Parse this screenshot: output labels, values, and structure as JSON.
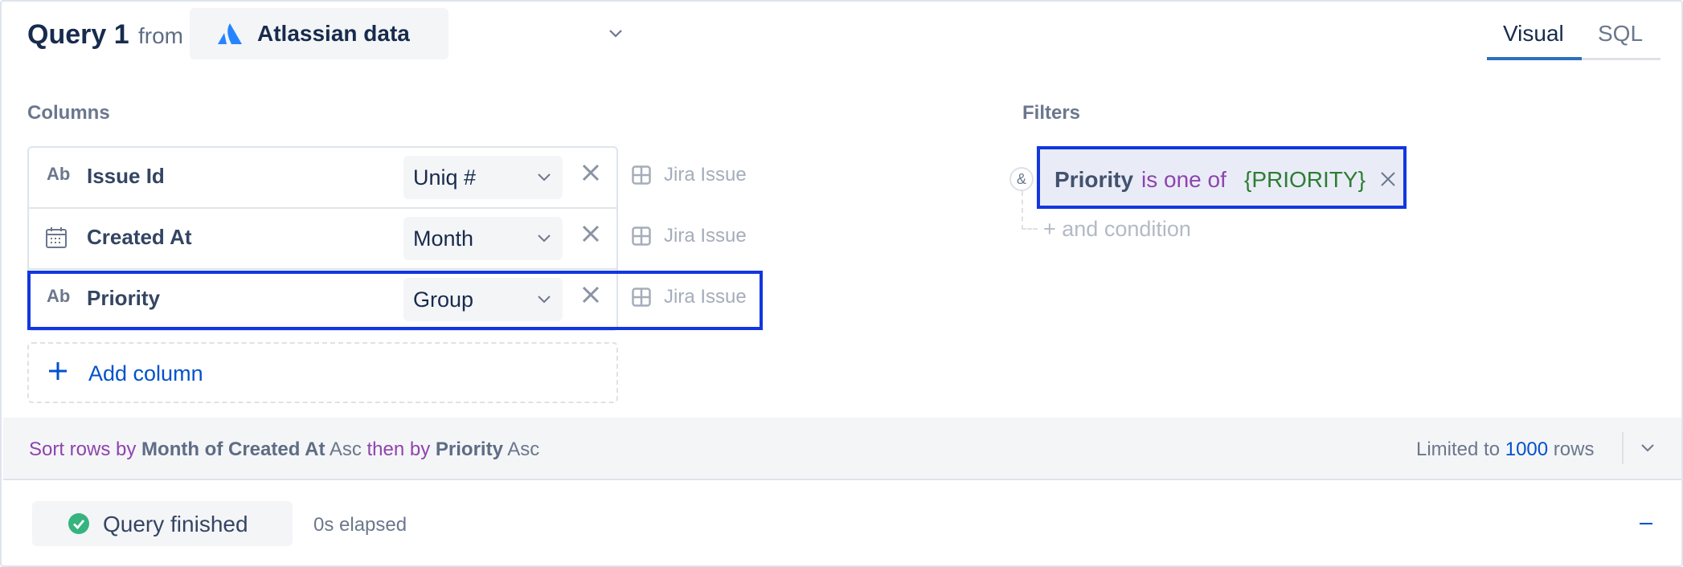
{
  "header": {
    "title": "Query 1",
    "from_label": "from",
    "source_name": "Atlassian data",
    "source_icon": "atlassian-logo-icon",
    "tabs": [
      {
        "label": "Visual",
        "active": true
      },
      {
        "label": "SQL",
        "active": false
      }
    ]
  },
  "columns_section": {
    "label": "Columns",
    "rows": [
      {
        "type_icon": "Ab",
        "name": "Issue Id",
        "aggregation": "Uniq #",
        "table": "Jira Issue"
      },
      {
        "type_icon": "calendar-icon",
        "name": "Created At",
        "aggregation": "Month",
        "table": "Jira Issue"
      },
      {
        "type_icon": "Ab",
        "name": "Priority",
        "aggregation": "Group",
        "table": "Jira Issue"
      }
    ],
    "add_label": "Add column"
  },
  "filters_section": {
    "label": "Filters",
    "combinator": "&",
    "filters": [
      {
        "column": "Priority",
        "operator": "is one of",
        "value": "{PRIORITY}"
      }
    ],
    "add_condition_label": "+ and condition"
  },
  "sort": {
    "prefix": "Sort rows by",
    "first_field": "Month of Created At",
    "first_dir": "Asc",
    "then": "then by",
    "second_field": "Priority",
    "second_dir": "Asc",
    "limit_prefix": "Limited to",
    "limit_value": "1000",
    "limit_suffix": "rows"
  },
  "status": {
    "label": "Query finished",
    "elapsed": "0s elapsed"
  },
  "colors": {
    "accent": "#0052cc",
    "highlight": "#1236e0",
    "keyword": "#8e44ad",
    "value": "#2e7d32",
    "success": "#36b37e"
  }
}
